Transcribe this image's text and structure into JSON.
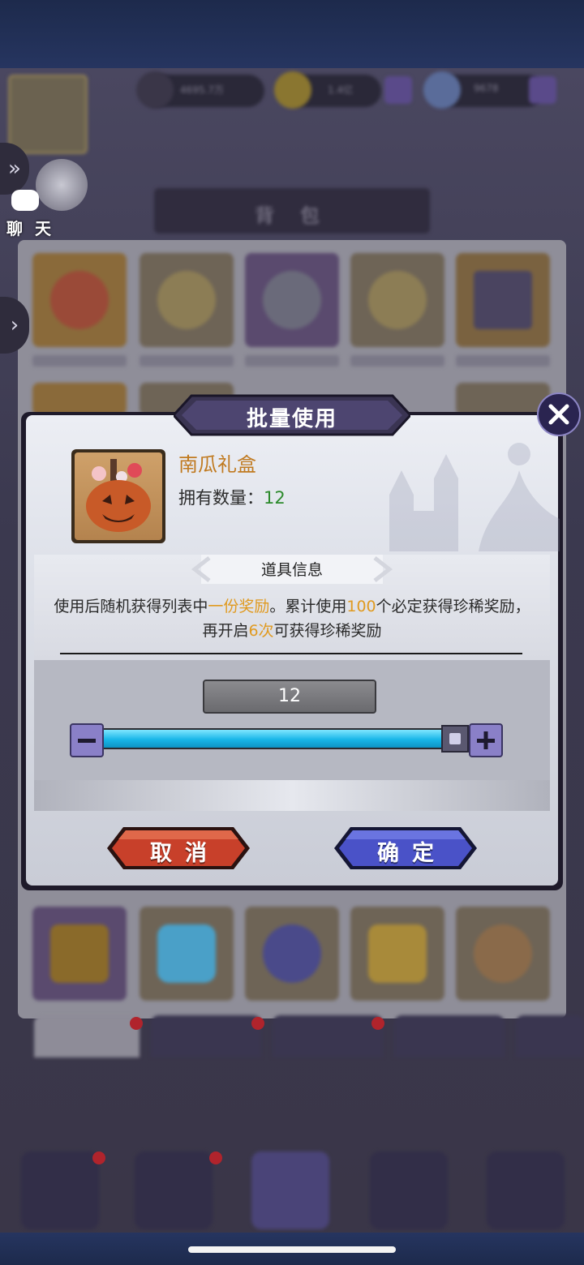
{
  "background": {
    "chat_label": "聊 天",
    "resources": [
      {
        "name": "trophy-icon",
        "value": "4695.7万"
      },
      {
        "name": "gold-coin-icon",
        "value": "1.4亿"
      },
      {
        "name": "diamond-icon",
        "value": "9678"
      }
    ],
    "panel_title": "背 包"
  },
  "dialog": {
    "title": "批量使用",
    "item": {
      "name": "南瓜礼盒",
      "owned_label": "拥有数量：",
      "owned_count": "12",
      "icon": "pumpkin-gift-box-icon"
    },
    "info_tab_label": "道具信息",
    "description": {
      "part1": "使用后随机获得列表中",
      "hl1": "一份奖励",
      "part2": "。累计使用",
      "hl2": "100",
      "part3": "个必定获得珍稀奖励，再开启",
      "hl3": "6次",
      "part4": "可获得珍稀奖励"
    },
    "quantity": "12",
    "slider": {
      "value": 12,
      "max": 12,
      "fraction": 1.0
    },
    "cancel_label": "取消",
    "confirm_label": "确定"
  },
  "colors": {
    "highlight": "#e09a20",
    "owned_count": "#2c8a2c",
    "item_name": "#c07a20",
    "slider_fill": "#18b6e8",
    "cancel_button": "#c8402a",
    "confirm_button": "#4a52c8"
  }
}
